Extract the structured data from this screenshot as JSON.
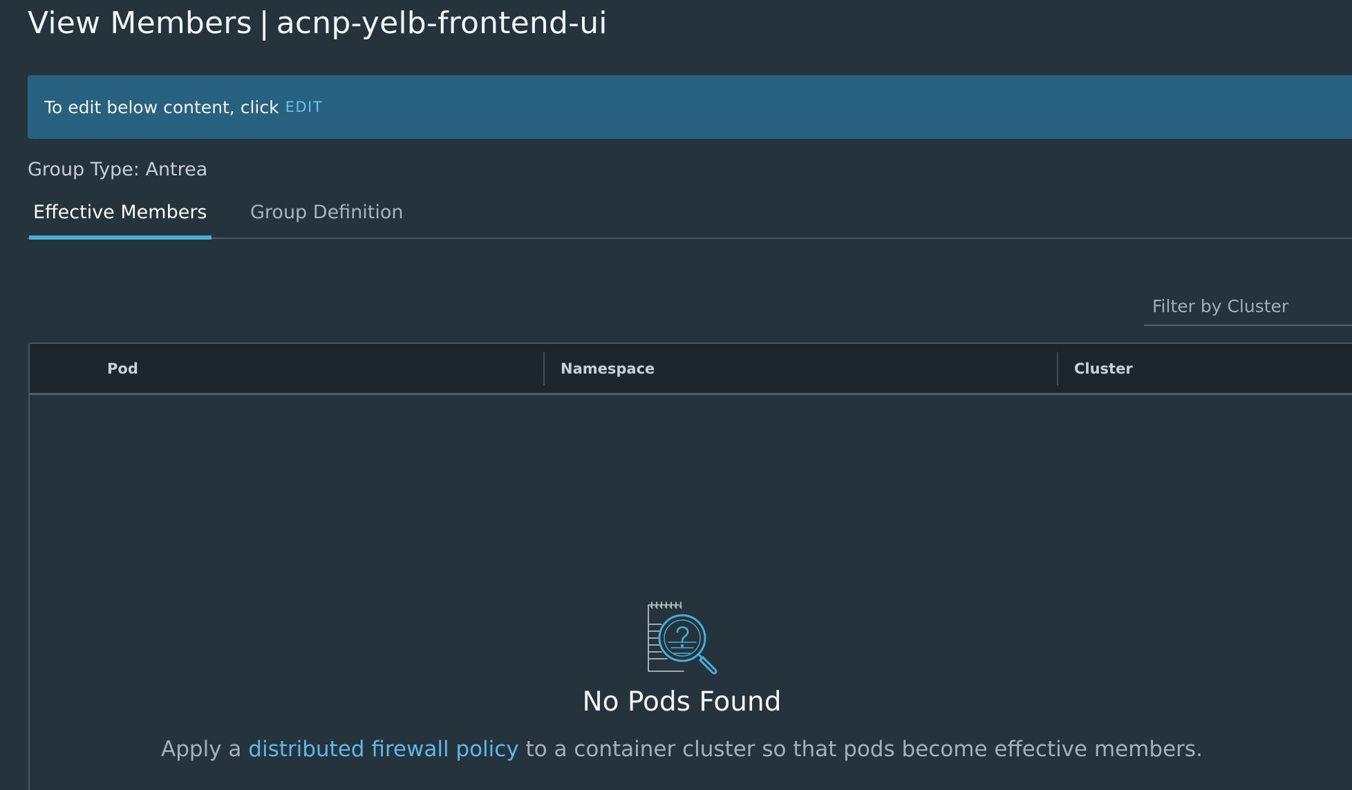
{
  "header": {
    "title_prefix": "View Members",
    "title_separator": "|",
    "group_name": "acnp-yelb-frontend-ui"
  },
  "banner": {
    "text": "To edit below content, click",
    "edit_label": "EDIT"
  },
  "group_type": "Group Type: Antrea",
  "tabs": [
    {
      "label": "Effective Members",
      "active": true
    },
    {
      "label": "Group Definition",
      "active": false
    }
  ],
  "filter": {
    "placeholder": "Filter by Cluster",
    "value": ""
  },
  "table": {
    "columns": [
      "Pod",
      "Namespace",
      "Cluster"
    ],
    "rows": []
  },
  "empty_state": {
    "icon": "notepad-search-icon",
    "title": "No Pods Found",
    "desc_before": "Apply a",
    "desc_link": "distributed firewall policy",
    "desc_after": "to a container cluster so that pods become effective members."
  },
  "colors": {
    "background": "#25333d",
    "banner": "#28607f",
    "accent": "#49afd9",
    "link": "#5fb8e6"
  }
}
